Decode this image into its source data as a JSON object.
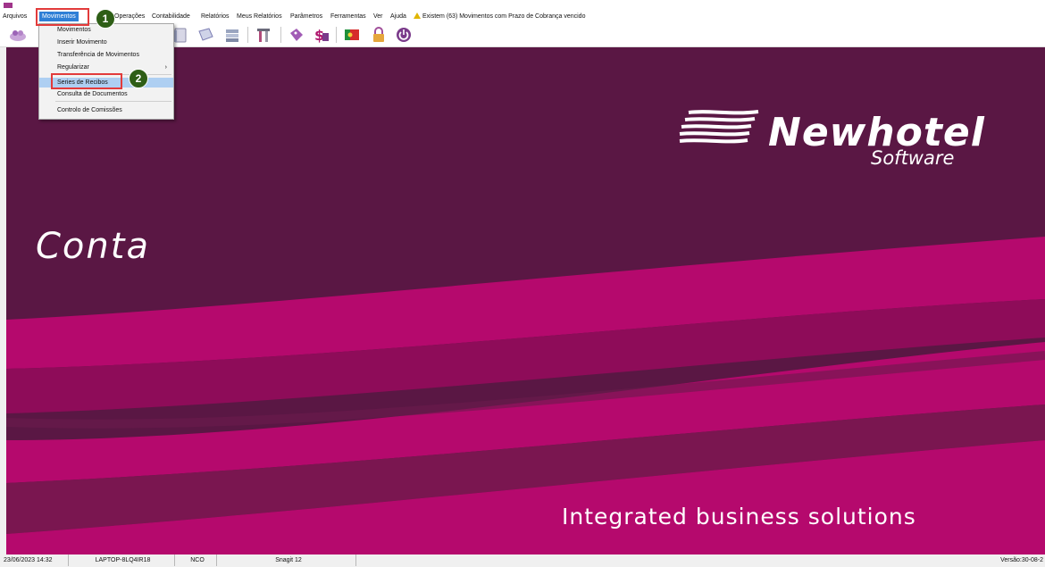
{
  "menubar": {
    "items": [
      "Arquivos",
      "Movimentos",
      "Operações",
      "Contabilidade",
      "Relatórios",
      "Meus Relatórios",
      "Parâmetros",
      "Ferramentas",
      "Ver",
      "Ajuda"
    ],
    "alert": "Existem (63) Movimentos com Prazo de Cobrança vencido"
  },
  "toolbar": {
    "icons": [
      "people-icon",
      "document-icon",
      "book-icon",
      "stack-icon",
      "tools-icon",
      "tag-icon",
      "money-icon",
      "portugal-flag-icon",
      "lock-icon",
      "power-icon"
    ]
  },
  "dropdown": {
    "items": [
      "Movimentos",
      "Inserir Movimento",
      "Transferência de Movimentos",
      "Regularizar",
      "Series de Recibos",
      "Consulta de Documentos",
      "Controlo de Comissões"
    ],
    "submenu_arrow": "›"
  },
  "callouts": {
    "step1": "1",
    "step2": "2"
  },
  "background": {
    "logo_word": "Newhotel",
    "logo_sub": "Software",
    "title": "Conta",
    "tagline": "Integrated business solutions"
  },
  "status": {
    "datetime": "23/06/2023 14:32",
    "machine": "LAPTOP-8LQ4IR18",
    "user": "NCO",
    "process": "Snagit 12",
    "version": "Versão:30-08-2"
  },
  "colors": {
    "dark_plum": "#5a1744",
    "magenta": "#b5096d",
    "highlight": "#aecff2",
    "menu_active": "#2f7fd6",
    "callout_green": "#2e5e16",
    "callout_red": "#e23b3b"
  }
}
